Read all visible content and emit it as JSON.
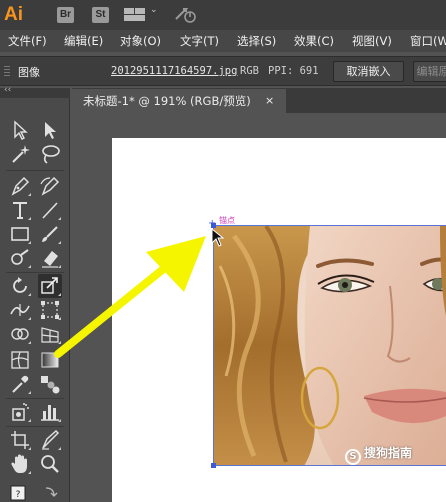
{
  "app": {
    "logo_text": "Ai",
    "bridge_label": "Br",
    "stock_label": "St"
  },
  "menu": {
    "items": [
      "文件(F)",
      "编辑(E)",
      "对象(O)",
      "文字(T)",
      "选择(S)",
      "效果(C)",
      "视图(V)",
      "窗口(W"
    ]
  },
  "control_bar": {
    "object_type": "图像",
    "file_name": "2012951117164597.jpg",
    "color_mode": "RGB",
    "ppi": "PPI: 691",
    "unembed_button": "取消嵌入",
    "edit_button": "编辑原"
  },
  "document": {
    "tab_title": "未标题-1* @ 191% (RGB/预览)",
    "close_glyph": "×"
  },
  "canvas": {
    "anchor_label": "锚点",
    "watermark": "搜狗指南",
    "watermark_logo": "S"
  },
  "colors": {
    "accent_orange": "#f7931e",
    "selection_blue": "#3b5bd9",
    "annotation_yellow": "#f5f500",
    "anchor_magenta": "#d23bc0"
  }
}
